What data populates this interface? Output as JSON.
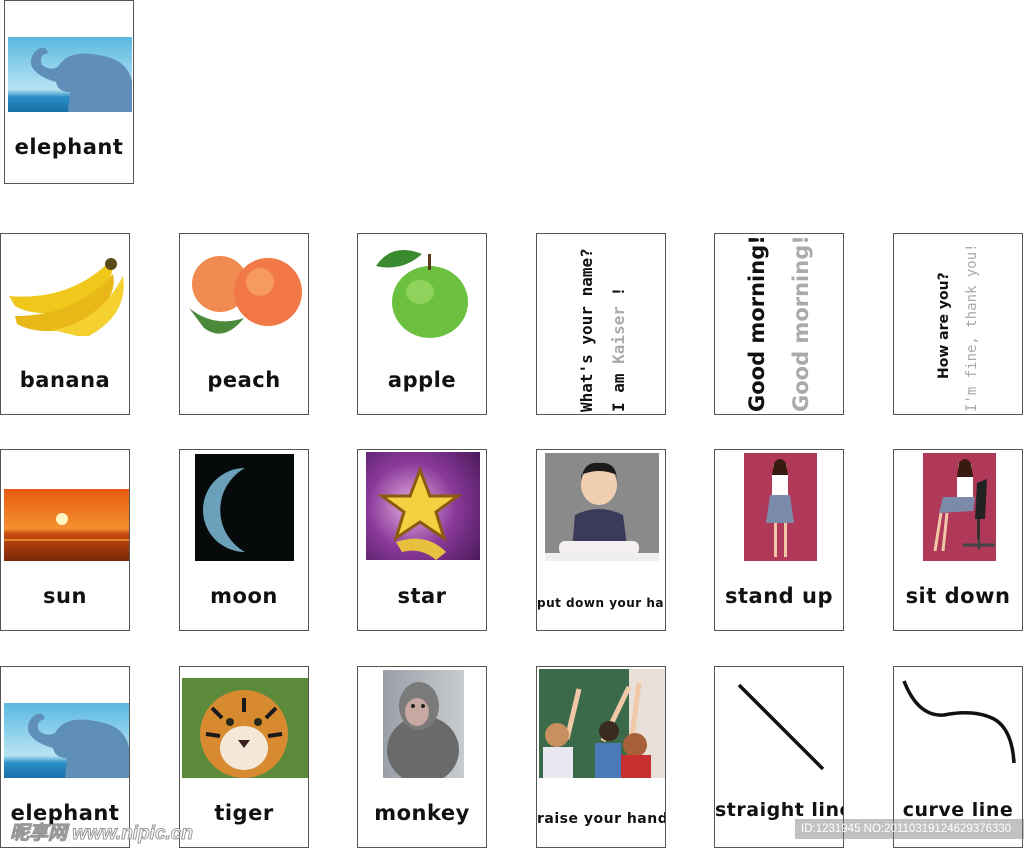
{
  "cards": {
    "top_elephant": {
      "label": "elephant",
      "picture": "elephant"
    },
    "banana": {
      "label": "banana",
      "picture": "banana"
    },
    "peach": {
      "label": "peach",
      "picture": "peach"
    },
    "apple": {
      "label": "apple",
      "picture": "green-apple"
    },
    "name": {
      "line1": "What's your name?",
      "line2_prefix": "I am ",
      "line2_name": "Kaiser",
      "line2_suffix": " !"
    },
    "morning": {
      "line1": "Good morning!",
      "line2": "Good morning!"
    },
    "how": {
      "line1": "How are you?",
      "line2": "I'm fine, thank you!"
    },
    "sun": {
      "label": "sun",
      "picture": "sunset"
    },
    "moon": {
      "label": "moon",
      "picture": "crescent-moon"
    },
    "star": {
      "label": "star",
      "picture": "gold-star"
    },
    "put_down": {
      "label": "put down your hand",
      "picture": "girl-at-desk"
    },
    "stand_up": {
      "label": "stand up",
      "picture": "woman-standing"
    },
    "sit_down": {
      "label": "sit down",
      "picture": "woman-sitting"
    },
    "elephant": {
      "label": "elephant",
      "picture": "elephant"
    },
    "tiger": {
      "label": "tiger",
      "picture": "tiger"
    },
    "monkey": {
      "label": "monkey",
      "picture": "monkey"
    },
    "raise": {
      "label": "raise your hand",
      "picture": "classroom-raising-hands"
    },
    "straight": {
      "label": "straight line",
      "picture": "straight-line"
    },
    "curve": {
      "label": "curve line",
      "picture": "curve-line"
    }
  },
  "colors": {
    "gray_text": "#aaaaaa",
    "border": "#555555"
  },
  "watermark": {
    "left": "昵享网 www.nipic.cn",
    "right": "ID:1231945 NO:20110319124629376330"
  }
}
